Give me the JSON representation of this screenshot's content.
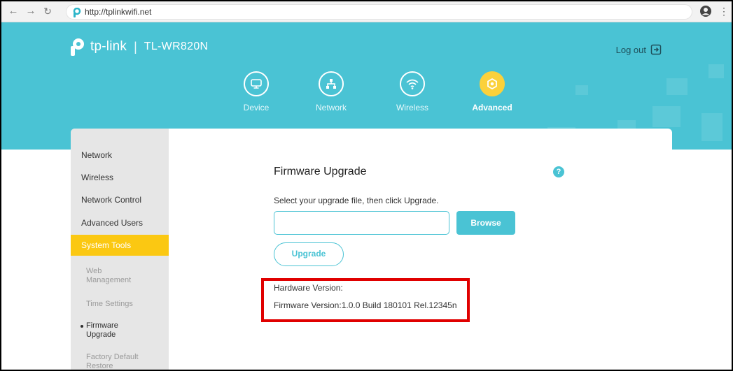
{
  "browser": {
    "back_icon": "arrow-left-icon",
    "forward_icon": "arrow-right-icon",
    "reload_icon": "reload-icon",
    "url": "http://tplinkwifi.net"
  },
  "header": {
    "brand": "tp-link",
    "separator": "|",
    "model": "TL-WR820N",
    "logout_label": "Log out",
    "nav": [
      {
        "label": "Device",
        "icon": "monitor-icon"
      },
      {
        "label": "Network",
        "icon": "network-icon"
      },
      {
        "label": "Wireless",
        "icon": "wifi-icon"
      },
      {
        "label": "Advanced",
        "icon": "gear-icon",
        "active": true
      }
    ]
  },
  "sidebar": {
    "items": [
      {
        "label": "Network"
      },
      {
        "label": "Wireless"
      },
      {
        "label": "Network Control"
      },
      {
        "label": "Advanced Users"
      },
      {
        "label": "System Tools",
        "active": true
      }
    ],
    "sub_items": [
      {
        "label": "Web Management"
      },
      {
        "label": "Time Settings"
      },
      {
        "label": "Firmware Upgrade",
        "active": true
      },
      {
        "label": "Factory Default Restore"
      }
    ]
  },
  "main": {
    "title": "Firmware Upgrade",
    "help": "?",
    "instruction": "Select your upgrade file, then click Upgrade.",
    "file_value": "",
    "browse_label": "Browse",
    "upgrade_label": "Upgrade",
    "hardware_version": "Hardware Version:",
    "firmware_version": "Firmware Version:1.0.0 Build 180101 Rel.12345n"
  },
  "colors": {
    "accent": "#4ac3d4",
    "highlight": "#fbc812",
    "annotation": "#e00000"
  }
}
